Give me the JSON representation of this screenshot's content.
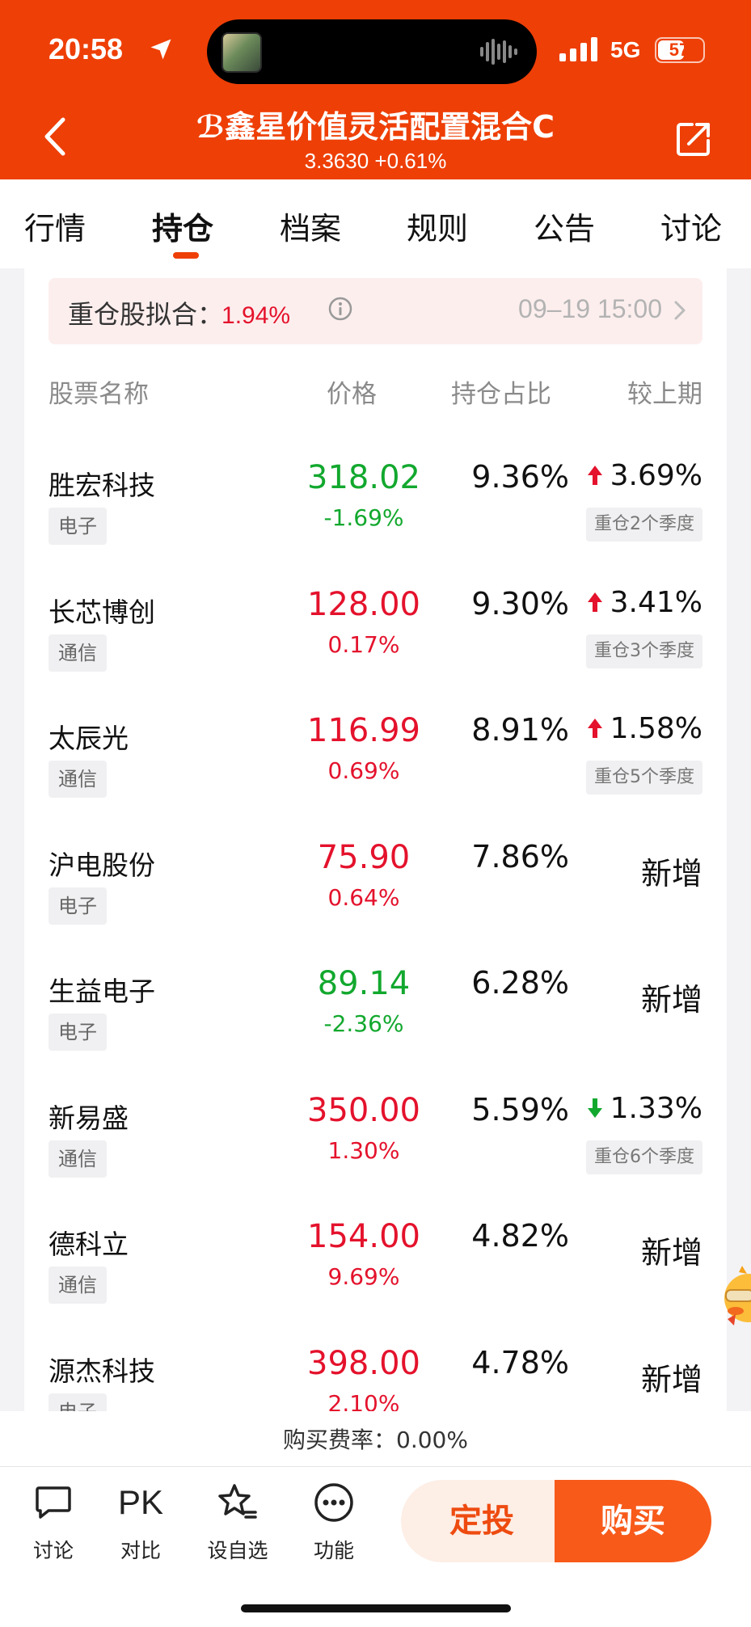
{
  "status_bar": {
    "time": "20:58",
    "network": "5G",
    "battery": "57"
  },
  "header": {
    "title": "ℬ鑫星价值灵活配置混合C",
    "nav": "3.3630",
    "change": "+0.61%"
  },
  "tabs": [
    "行情",
    "持仓",
    "档案",
    "规则",
    "公告",
    "讨论"
  ],
  "active_tab": "持仓",
  "fit": {
    "label": "重仓股拟合：",
    "value": "1.94%",
    "time": "09–19 15:00"
  },
  "columns": {
    "name": "股票名称",
    "price": "价格",
    "weight": "持仓占比",
    "change": "较上期"
  },
  "holdings": [
    {
      "name": "胜宏科技",
      "sector": "电子",
      "price": "318.02",
      "pct": "-1.69%",
      "trend": "down",
      "weight": "9.36%",
      "change": "3.69%",
      "change_dir": "up",
      "badge": "重仓2个季度"
    },
    {
      "name": "长芯博创",
      "sector": "通信",
      "price": "128.00",
      "pct": "0.17%",
      "trend": "up",
      "weight": "9.30%",
      "change": "3.41%",
      "change_dir": "up",
      "badge": "重仓3个季度"
    },
    {
      "name": "太辰光",
      "sector": "通信",
      "price": "116.99",
      "pct": "0.69%",
      "trend": "up",
      "weight": "8.91%",
      "change": "1.58%",
      "change_dir": "up",
      "badge": "重仓5个季度"
    },
    {
      "name": "沪电股份",
      "sector": "电子",
      "price": "75.90",
      "pct": "0.64%",
      "trend": "up",
      "weight": "7.86%",
      "new": "新增"
    },
    {
      "name": "生益电子",
      "sector": "电子",
      "price": "89.14",
      "pct": "-2.36%",
      "trend": "down",
      "weight": "6.28%",
      "new": "新增"
    },
    {
      "name": "新易盛",
      "sector": "通信",
      "price": "350.00",
      "pct": "1.30%",
      "trend": "up",
      "weight": "5.59%",
      "change": "1.33%",
      "change_dir": "down",
      "badge": "重仓6个季度"
    },
    {
      "name": "德科立",
      "sector": "通信",
      "price": "154.00",
      "pct": "9.69%",
      "trend": "up",
      "weight": "4.82%",
      "new": "新增"
    },
    {
      "name": "源杰科技",
      "sector": "电子",
      "price": "398.00",
      "pct": "2.10%",
      "trend": "up",
      "weight": "4.78%",
      "new": "新增"
    }
  ],
  "fee": "购买费率：0.00%",
  "bottom": {
    "discuss": "讨论",
    "pk_icon": "PK",
    "compare": "对比",
    "watchlist": "设自选",
    "functions": "功能",
    "dca": "定投",
    "buy": "购买"
  },
  "colors": {
    "brand": "#ee3f06",
    "up": "#e4122c",
    "down": "#12a82e"
  }
}
